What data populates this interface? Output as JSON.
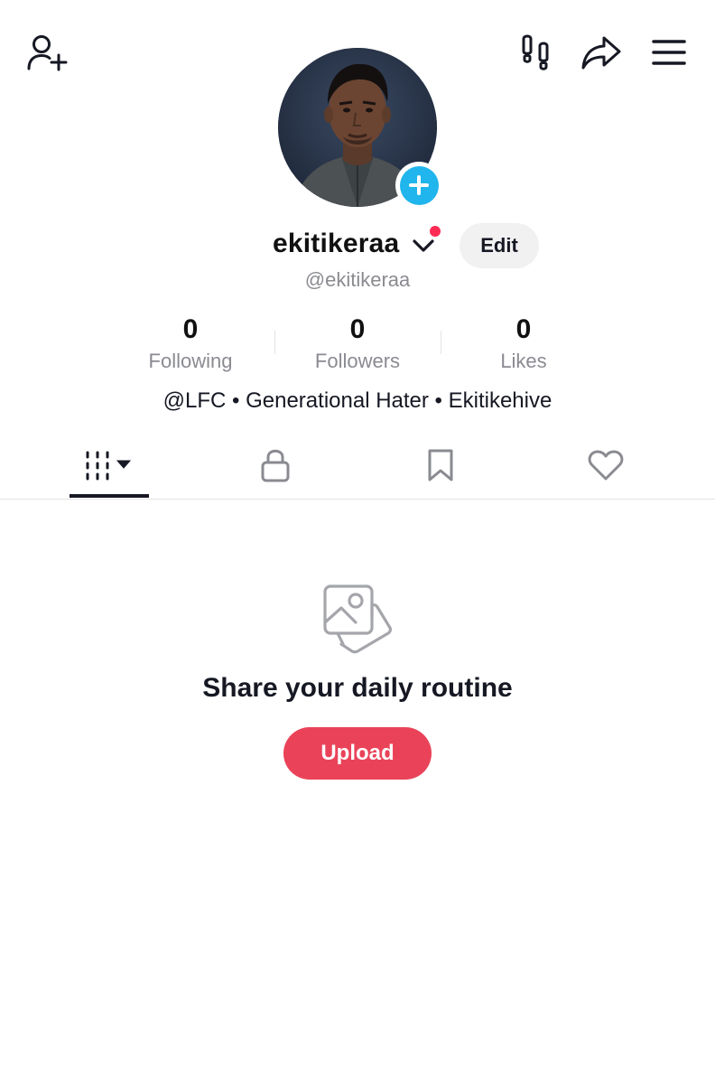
{
  "header": {
    "icons": [
      "add-friend-icon",
      "footprint-icon",
      "share-icon",
      "menu-icon"
    ]
  },
  "profile": {
    "avatar_icon": "plus-icon",
    "username": "ekitikeraa",
    "handle": "@ekitikeraa",
    "edit_label": "Edit",
    "bio": "@LFC • Generational Hater • Ekitikehive",
    "notification_dot_color": "#fe2c55",
    "add_badge_color": "#20b5ec"
  },
  "stats": [
    {
      "value": "0",
      "label": "Following"
    },
    {
      "value": "0",
      "label": "Followers"
    },
    {
      "value": "0",
      "label": "Likes"
    }
  ],
  "tabs": [
    {
      "name": "videos",
      "icon": "grid-icon",
      "selected": true
    },
    {
      "name": "private",
      "icon": "lock-icon",
      "selected": false
    },
    {
      "name": "favorites",
      "icon": "bookmark-icon",
      "selected": false
    },
    {
      "name": "liked",
      "icon": "heart-icon",
      "selected": false
    }
  ],
  "empty_state": {
    "icon": "photos-icon",
    "title": "Share your daily routine",
    "button_label": "Upload",
    "button_color": "#ea4359"
  }
}
